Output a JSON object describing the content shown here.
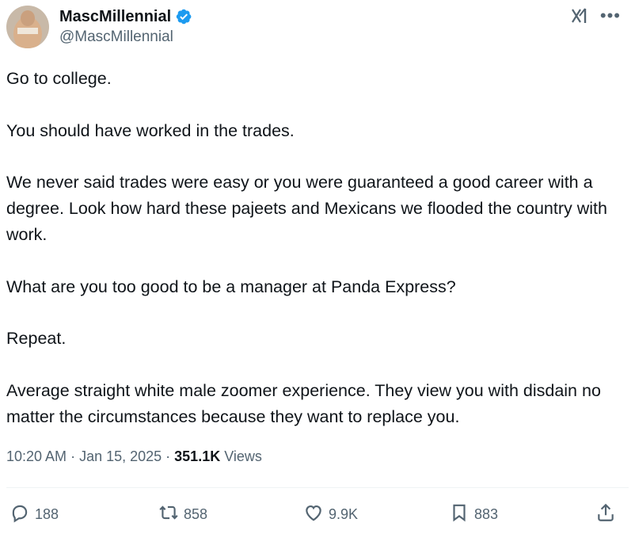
{
  "author": {
    "display_name": "MascMillennial",
    "handle": "@MascMillennial"
  },
  "tweet": {
    "paragraphs": [
      "Go to college.",
      "You should have worked in the trades.",
      "We never said trades were easy or you were guaranteed a good career with a degree. Look how hard these pajeets and Mexicans we flooded the country with work.",
      "What are you too good to be a manager at Panda Express?",
      "Repeat.",
      "Average straight white male zoomer experience. They view you with disdain no matter the circumstances because they want to replace you."
    ],
    "time": "10:20 AM",
    "separator1": " · ",
    "date": "Jan 15, 2025",
    "separator2": " · ",
    "views_count": "351.1K",
    "views_label": "Views"
  },
  "actions": {
    "replies": "188",
    "reposts": "858",
    "likes": "9.9K",
    "bookmarks": "883"
  },
  "icons": {
    "verified": "verified-badge-icon",
    "grok": "grok-icon",
    "more": "more-icon",
    "reply": "reply-icon",
    "repost": "repost-icon",
    "like": "heart-icon",
    "bookmark": "bookmark-icon",
    "share": "share-icon"
  },
  "colors": {
    "verified": "#1d9bf0",
    "text": "#0f1419",
    "muted": "#536471"
  }
}
